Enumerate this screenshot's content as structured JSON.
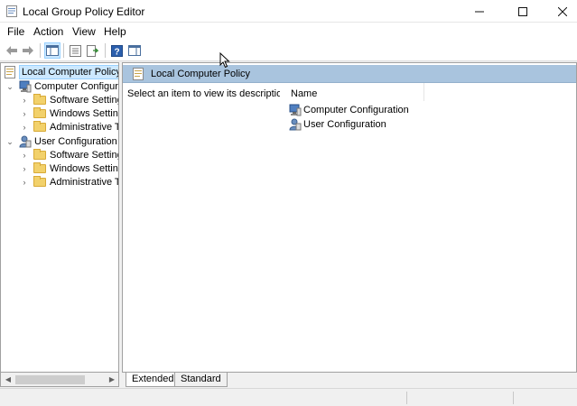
{
  "window": {
    "title": "Local Group Policy Editor",
    "min_glyph": "—",
    "max_glyph": "☐",
    "close_glyph": "✕"
  },
  "menu": [
    "File",
    "Action",
    "View",
    "Help"
  ],
  "toolbar": {
    "icons": [
      "back-arrow-icon",
      "forward-arrow-icon",
      "show-hide-console-tree-icon",
      "properties-icon",
      "export-list-icon",
      "help-icon",
      "show-hide-action-pane-icon"
    ]
  },
  "tree": {
    "root": "Local Computer Policy",
    "computer": {
      "label": "Computer Configura",
      "children": [
        "Software Settings",
        "Windows Setting",
        "Administrative Te"
      ]
    },
    "user": {
      "label": "User Configuration",
      "children": [
        "Software Settings",
        "Windows Setting",
        "Administrative Te"
      ]
    }
  },
  "right": {
    "header": "Local Computer Policy",
    "description": "Select an item to view its description.",
    "column_name": "Name",
    "items": [
      "Computer Configuration",
      "User Configuration"
    ]
  },
  "tabs": [
    "Extended",
    "Standard"
  ],
  "colors": {
    "header_band": "#a9c4de",
    "selection": "#cce8ff"
  }
}
